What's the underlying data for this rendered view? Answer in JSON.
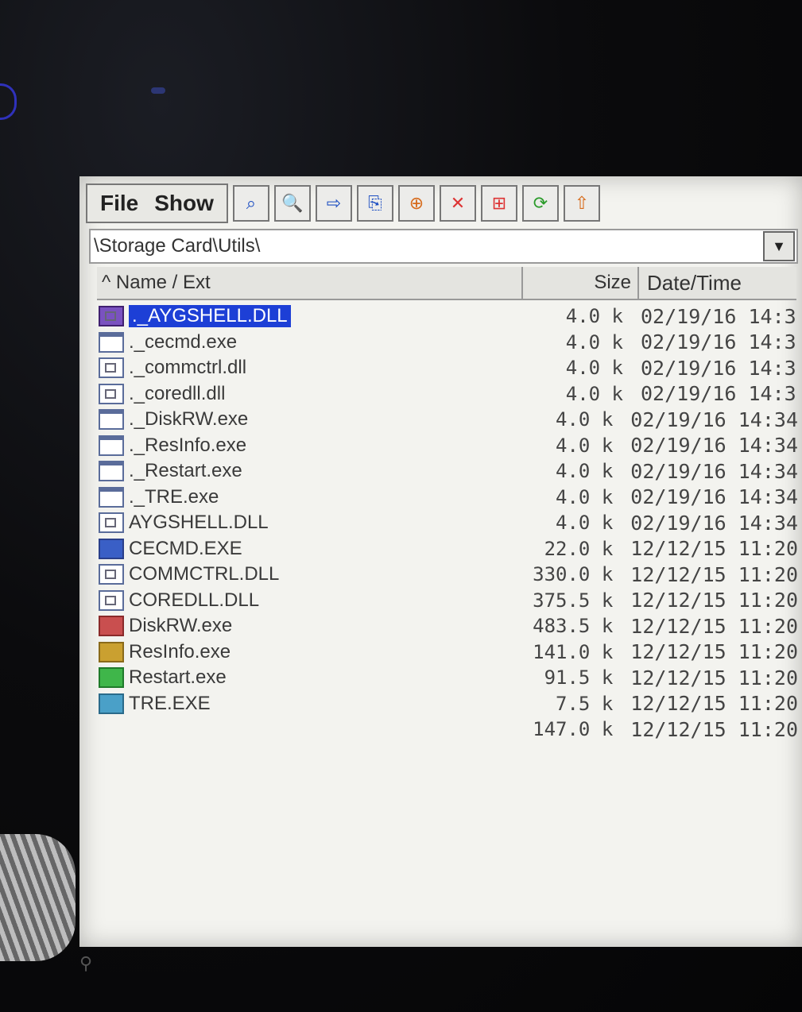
{
  "toolbar": {
    "menus": [
      "File",
      "Show"
    ],
    "buttons": [
      {
        "name": "find-icon",
        "glyph": "⌕"
      },
      {
        "name": "search-file-icon",
        "glyph": "🔍"
      },
      {
        "name": "copy-icon",
        "glyph": "⇨"
      },
      {
        "name": "paste-icon",
        "glyph": "⎘"
      },
      {
        "name": "new-folder-icon",
        "glyph": "⊕"
      },
      {
        "name": "delete-icon",
        "glyph": "✕"
      },
      {
        "name": "view-grid-icon",
        "glyph": "⊞"
      },
      {
        "name": "refresh-icon",
        "glyph": "⟳"
      },
      {
        "name": "up-folder-icon",
        "glyph": "⇧"
      }
    ]
  },
  "path": {
    "value": "\\Storage Card\\Utils\\"
  },
  "list_header": {
    "name": "^ Name / Ext",
    "size": "Size",
    "date": "Date/Time"
  },
  "files": [
    {
      "name": "._AYGSHELL.DLL",
      "size": "4.0 k",
      "date": "02/19/16 14:3",
      "icon": "dll",
      "selected": true
    },
    {
      "name": "._cecmd.exe",
      "size": "4.0 k",
      "date": "02/19/16 14:3",
      "icon": "exe"
    },
    {
      "name": "._commctrl.dll",
      "size": "4.0 k",
      "date": "02/19/16 14:3",
      "icon": "dll"
    },
    {
      "name": "._coredll.dll",
      "size": "4.0 k",
      "date": "02/19/16 14:3",
      "icon": "dll"
    },
    {
      "name": "._DiskRW.exe",
      "size": "4.0 k",
      "date": "02/19/16 14:34",
      "icon": "exe"
    },
    {
      "name": "._ResInfo.exe",
      "size": "4.0 k",
      "date": "02/19/16 14:34",
      "icon": "exe"
    },
    {
      "name": "._Restart.exe",
      "size": "4.0 k",
      "date": "02/19/16 14:34",
      "icon": "exe"
    },
    {
      "name": "._TRE.exe",
      "size": "4.0 k",
      "date": "02/19/16 14:34",
      "icon": "exe"
    },
    {
      "name": "AYGSHELL.DLL",
      "size": "4.0 k",
      "date": "02/19/16 14:34",
      "icon": "dll"
    },
    {
      "name": "CECMD.EXE",
      "size": "22.0 k",
      "date": "12/12/15 11:20",
      "icon": "app1"
    },
    {
      "name": "COMMCTRL.DLL",
      "size": "330.0 k",
      "date": "12/12/15 11:20",
      "icon": "dll"
    },
    {
      "name": "COREDLL.DLL",
      "size": "375.5 k",
      "date": "12/12/15 11:20",
      "icon": "dll"
    },
    {
      "name": "DiskRW.exe",
      "size": "483.5 k",
      "date": "12/12/15 11:20",
      "icon": "app2"
    },
    {
      "name": "ResInfo.exe",
      "size": "141.0 k",
      "date": "12/12/15 11:20",
      "icon": "app3"
    },
    {
      "name": "Restart.exe",
      "size": "91.5 k",
      "date": "12/12/15 11:20",
      "icon": "app4"
    },
    {
      "name": "TRE.EXE",
      "size": "7.5 k",
      "date": "12/12/15 11:20",
      "icon": "app5"
    },
    {
      "name": "",
      "size": "147.0 k",
      "date": "12/12/15 11:20",
      "icon": "none"
    }
  ]
}
